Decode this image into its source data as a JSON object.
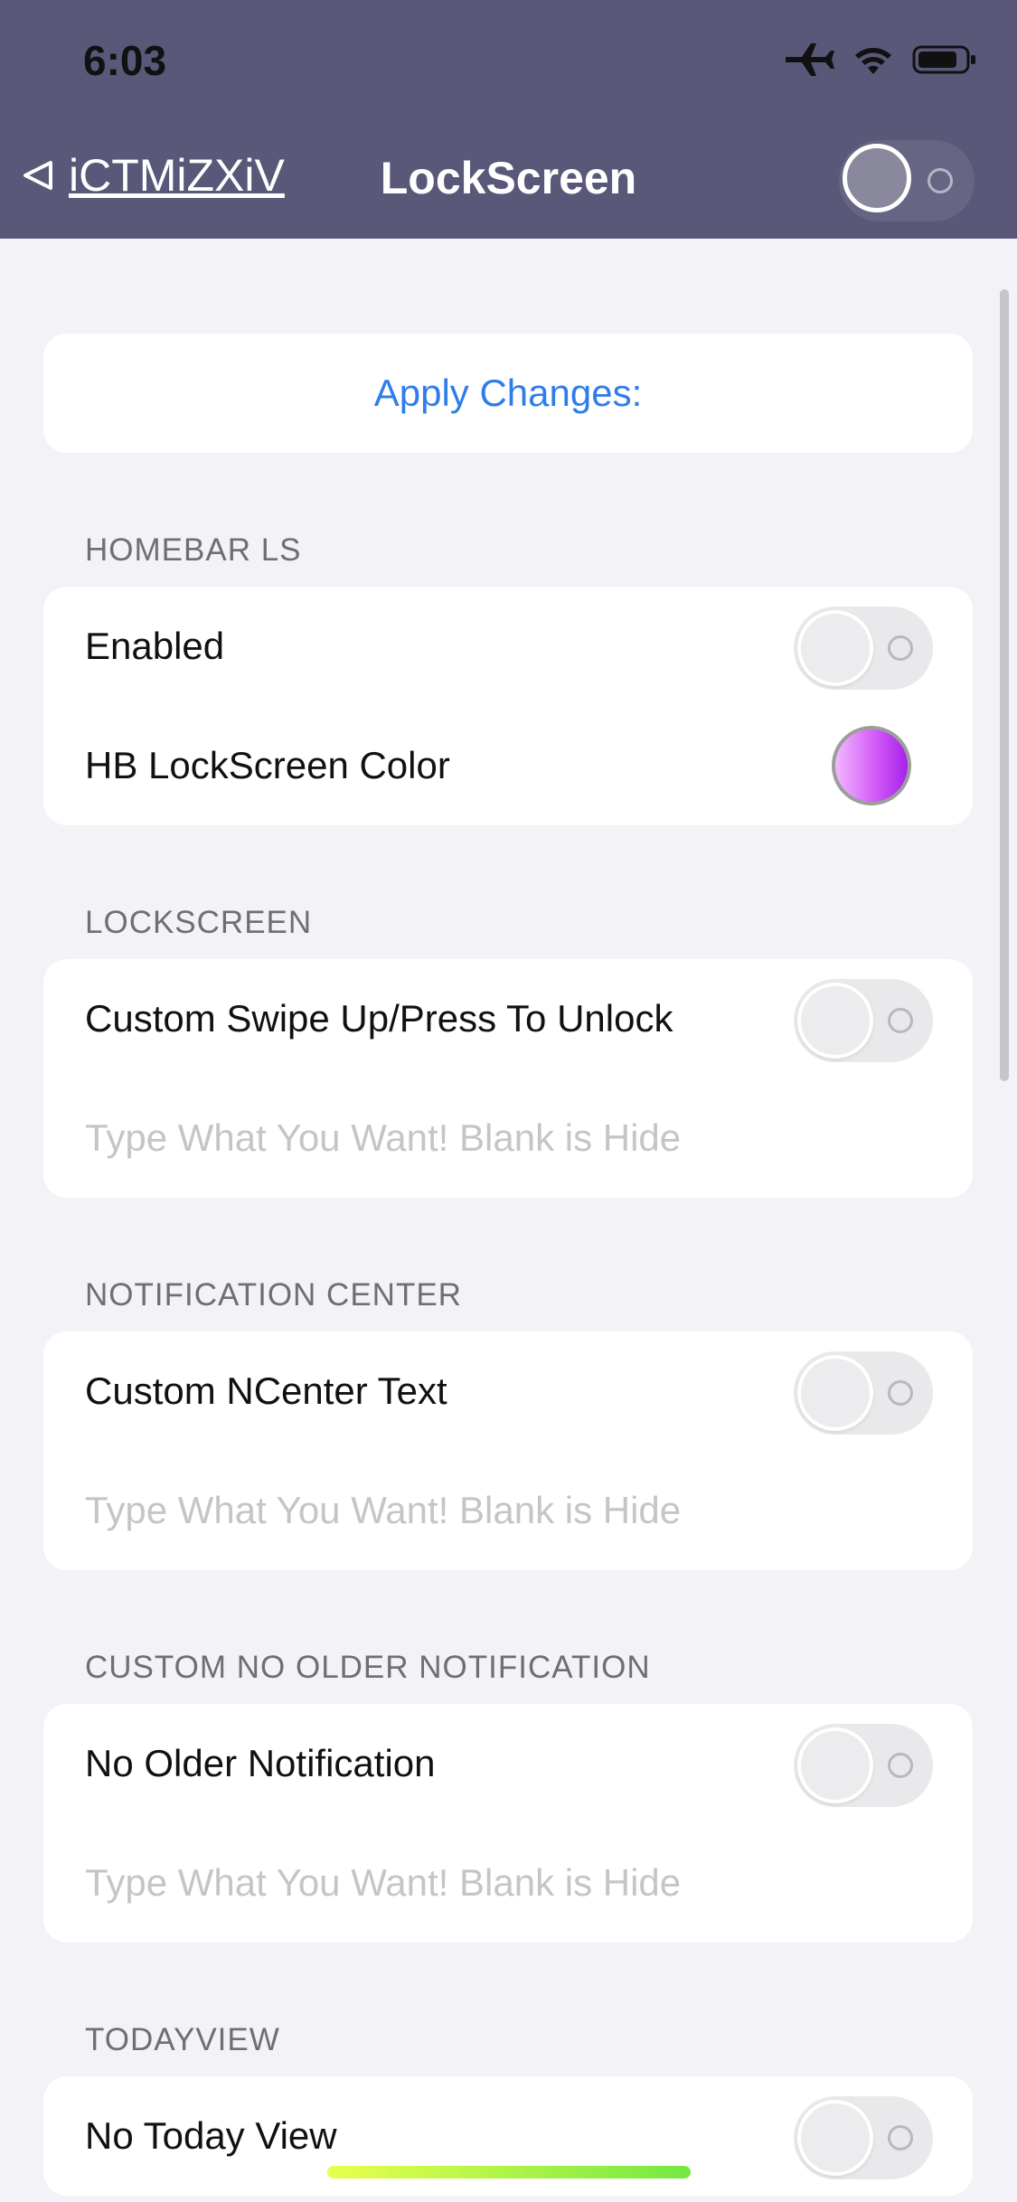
{
  "status_bar": {
    "time": "6:03",
    "icons": [
      "airplane-icon",
      "wifi-icon",
      "battery-icon"
    ]
  },
  "navbar": {
    "back_label": "iCTMiZXiV",
    "title": "LockScreen",
    "header_toggle_on": false
  },
  "apply_button": {
    "label": "Apply Changes:"
  },
  "sections": {
    "homebar": {
      "title": "HOMEBAR LS",
      "enabled_label": "Enabled",
      "enabled_on": false,
      "color_label": "HB LockScreen Color"
    },
    "lockscreen": {
      "title": "LOCKSCREEN",
      "toggle_label": "Custom Swipe Up/Press To Unlock",
      "toggle_on": false,
      "input_placeholder": "Type What You Want! Blank is Hide"
    },
    "notification_center": {
      "title": "NOTIFICATION CENTER",
      "toggle_label": "Custom NCenter Text",
      "toggle_on": false,
      "input_placeholder": "Type What You Want! Blank is Hide"
    },
    "no_older": {
      "title": "CUSTOM NO OLDER NOTIFICATION",
      "toggle_label": "No Older Notification",
      "toggle_on": false,
      "input_placeholder": "Type What You Want! Blank is Hide"
    },
    "todayview": {
      "title": "TODAYVIEW",
      "toggle_label": "No Today View",
      "toggle_on": false
    }
  },
  "colors": {
    "header_bg": "#5a5879",
    "accent": "#2f7dea",
    "page_bg": "#f2f2f7",
    "hb_color_swatch": "#d35cf7"
  }
}
